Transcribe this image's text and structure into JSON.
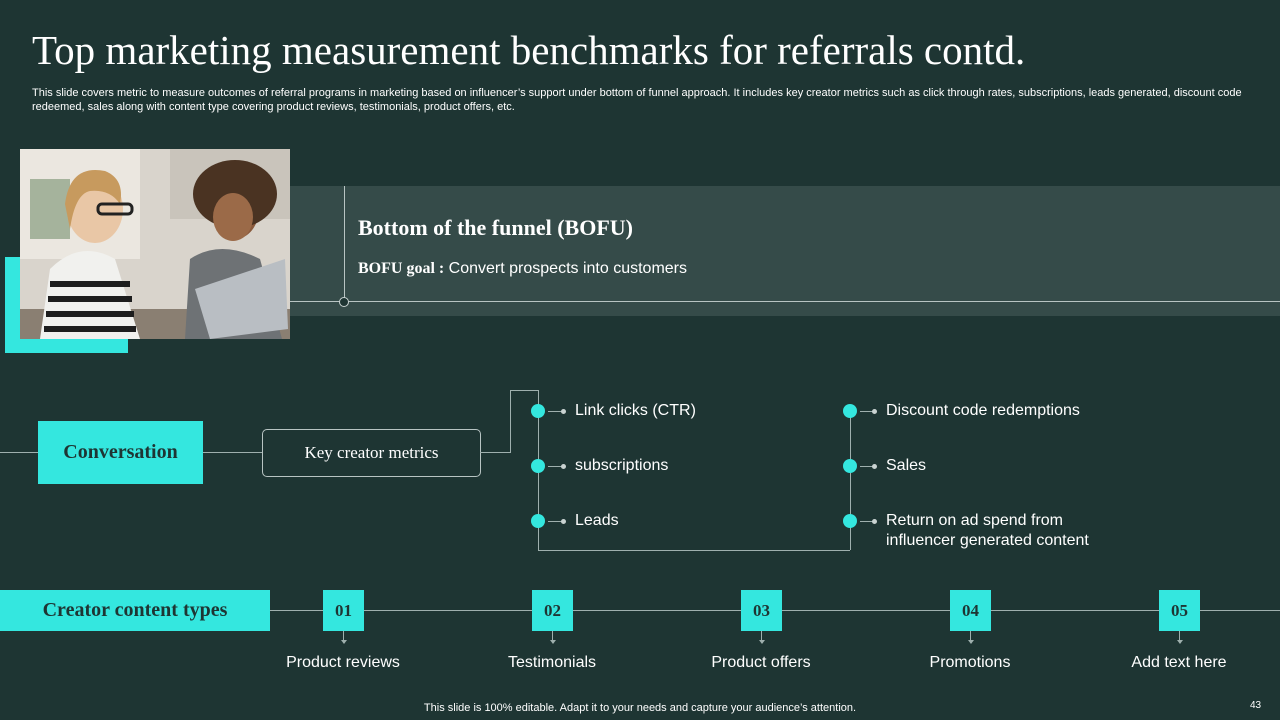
{
  "title": "Top marketing measurement benchmarks for referrals contd.",
  "subtitle": "This slide covers metric to measure outcomes of referral programs in marketing based on influencer’s support under bottom of funnel approach. It includes key creator metrics such as click through rates, subscriptions, leads generated, discount code redeemed, sales along with content type covering product reviews, testimonials, product offers, etc.",
  "bofu": {
    "heading": "Bottom of the funnel (BOFU)",
    "goal_label": "BOFU goal :",
    "goal_text": "Convert prospects into customers"
  },
  "conversation_label": "Conversation",
  "key_creator_metrics_label": "Key creator metrics",
  "metrics_left": [
    "Link clicks (CTR)",
    "subscriptions",
    "Leads"
  ],
  "metrics_right": [
    "Discount code redemptions",
    "Sales",
    "Return  on ad spend from influencer generated content"
  ],
  "creator_content": {
    "label": "Creator content types",
    "items": [
      {
        "num": "01",
        "label": "Product reviews"
      },
      {
        "num": "02",
        "label": "Testimonials"
      },
      {
        "num": "03",
        "label": "Product offers"
      },
      {
        "num": "04",
        "label": "Promotions"
      },
      {
        "num": "05",
        "label": "Add text here"
      }
    ]
  },
  "footer": "This slide is 100% editable. Adapt it to your needs and capture your audience’s attention.",
  "page_number": "43",
  "colors": {
    "background": "#1e3533",
    "accent": "#34e7df",
    "panel": "#354b49"
  }
}
